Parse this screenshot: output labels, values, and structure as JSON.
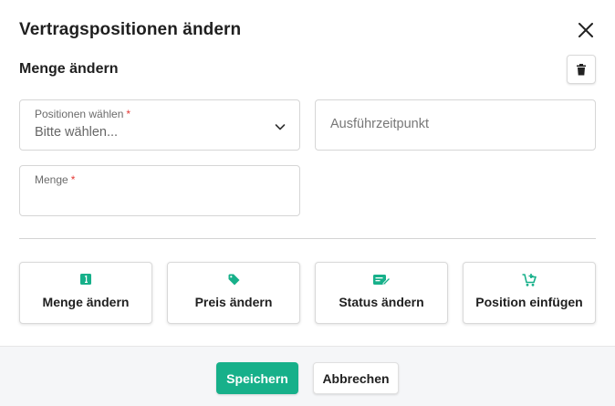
{
  "dialog": {
    "title": "Vertragspositionen ändern",
    "section_title": "Menge ändern",
    "accent_color": "#17b08a"
  },
  "fields": {
    "positionen": {
      "label": "Positionen wählen",
      "required_mark": "*",
      "value": "Bitte wählen..."
    },
    "ausfuehrzeitpunkt": {
      "placeholder": "Ausführzeitpunkt"
    },
    "menge": {
      "label": "Menge",
      "required_mark": "*",
      "value": ""
    }
  },
  "actions": [
    {
      "label": "Menge ändern",
      "icon": "quantity-one-icon"
    },
    {
      "label": "Preis ändern",
      "icon": "price-tag-icon"
    },
    {
      "label": "Status ändern",
      "icon": "status-edit-icon"
    },
    {
      "label": "Position einfügen",
      "icon": "cart-add-icon"
    }
  ],
  "footer": {
    "save_label": "Speichern",
    "cancel_label": "Abbrechen"
  }
}
